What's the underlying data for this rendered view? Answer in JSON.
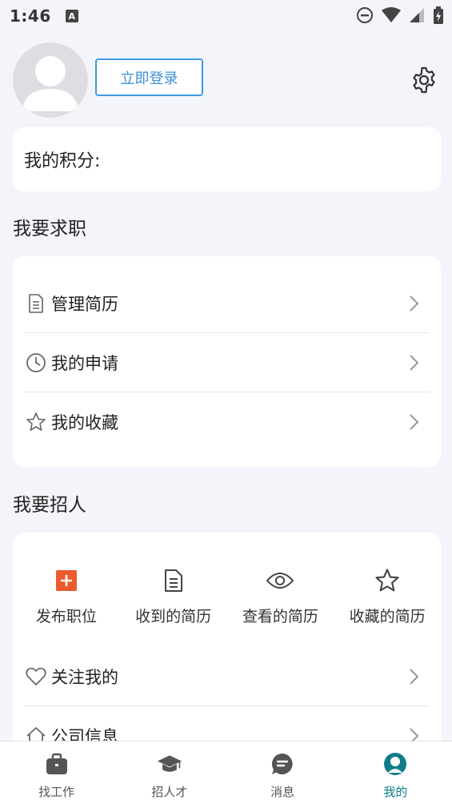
{
  "status": {
    "time": "1:46",
    "a_badge": "A"
  },
  "header": {
    "login_label": "立即登录"
  },
  "points": {
    "label": "我的积分:"
  },
  "job_seek": {
    "title": "我要求职",
    "items": [
      {
        "label": "管理简历",
        "icon": "document-icon"
      },
      {
        "label": "我的申请",
        "icon": "clock-icon"
      },
      {
        "label": "我的收藏",
        "icon": "star-icon"
      }
    ]
  },
  "recruit": {
    "title": "我要招人",
    "grid": [
      {
        "label": "发布职位",
        "icon": "add-icon"
      },
      {
        "label": "收到的简历",
        "icon": "document-icon"
      },
      {
        "label": "查看的简历",
        "icon": "eye-icon"
      },
      {
        "label": "收藏的简历",
        "icon": "star-icon"
      }
    ],
    "items": [
      {
        "label": "关注我的",
        "icon": "heart-icon"
      },
      {
        "label": "公司信息",
        "icon": "home-icon"
      }
    ]
  },
  "nav": {
    "items": [
      {
        "label": "找工作",
        "icon": "briefcase-icon"
      },
      {
        "label": "招人才",
        "icon": "graduation-cap-icon"
      },
      {
        "label": "消息",
        "icon": "message-icon"
      },
      {
        "label": "我的",
        "icon": "profile-icon"
      }
    ],
    "active_index": 3
  },
  "colors": {
    "accent": "#0f7b8a",
    "login_blue": "#3b9be0",
    "add_red": "#ec5a2e"
  }
}
